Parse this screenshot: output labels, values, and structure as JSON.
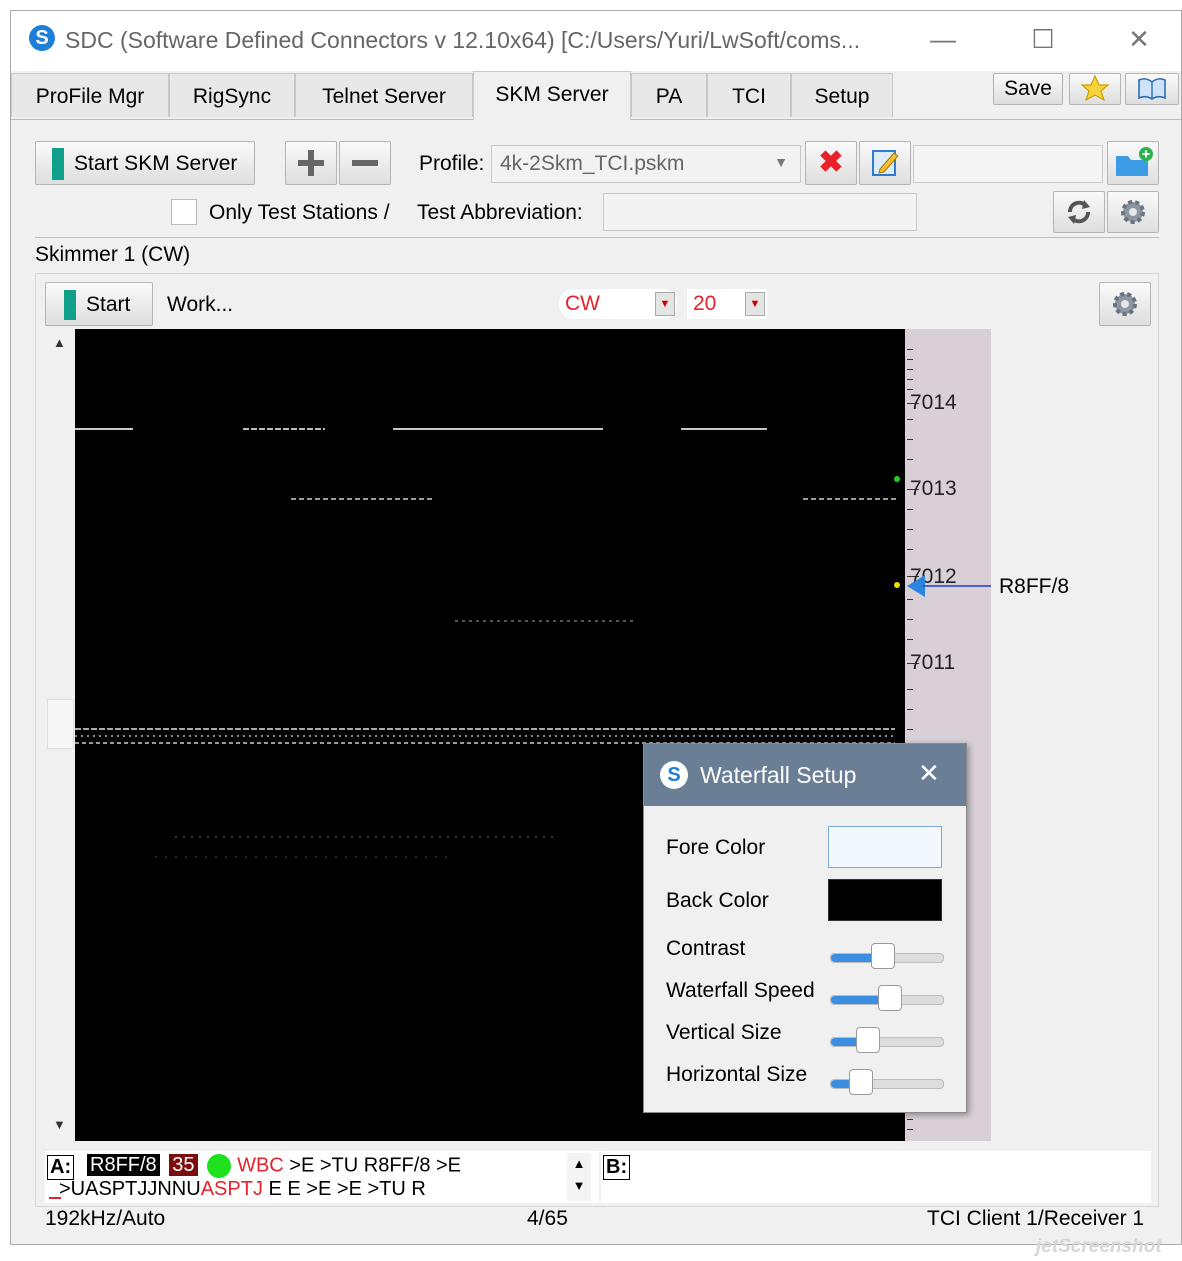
{
  "window": {
    "title": "SDC (Software Defined Connectors v 12.10x64) [C:/Users/Yuri/LwSoft/coms...",
    "logo_letter": "S",
    "minimize": "—",
    "maximize": "☐",
    "close": "✕"
  },
  "tabs": [
    {
      "label": "ProFile Mgr"
    },
    {
      "label": "RigSync"
    },
    {
      "label": "Telnet Server"
    },
    {
      "label": "SKM Server"
    },
    {
      "label": "PA"
    },
    {
      "label": "TCI"
    },
    {
      "label": "Setup"
    }
  ],
  "toolbar": {
    "save_label": "Save"
  },
  "server": {
    "start_label": "Start SKM Server",
    "profile_label": "Profile:",
    "profile_value": "4k-2Skm_TCI.pskm",
    "only_test_label": "Only Test Stations /",
    "test_abbrev_label": "Test Abbreviation:",
    "test_abbrev_value": ""
  },
  "skimmer": {
    "title": "Skimmer 1 (CW)",
    "start_label": "Start",
    "status": "Work...",
    "mode": "CW",
    "speed": "20"
  },
  "scale": {
    "labels": [
      "7014",
      "7013",
      "7012",
      "7011"
    ],
    "spot_call": "R8FF/8"
  },
  "decoder": {
    "a_label": "A:",
    "b_label": "B:",
    "line1_call": "R8FF/8",
    "line1_snr": "35",
    "line1_red": "WBC",
    "line1_rest": ">E >TU R8FF/8 >E",
    "line2_prefix": ">UASPTJJNNU",
    "line2_red": "ASPTJ",
    "line2_rest": "E E >E >E >TU R"
  },
  "waterfall_dialog": {
    "title": "Waterfall Setup",
    "logo_letter": "S",
    "close": "✕",
    "fore_color_label": "Fore Color",
    "back_color_label": "Back Color",
    "contrast_label": "Contrast",
    "speed_label": "Waterfall Speed",
    "vertical_label": "Vertical Size",
    "horizontal_label": "Horizontal Size",
    "fore_color": "#f3f7fe",
    "back_color": "#000000",
    "contrast_level": 0.45,
    "speed_level": 0.53,
    "vertical_level": 0.28,
    "horizontal_level": 0.2
  },
  "status": {
    "left": "192kHz/Auto",
    "center": "4/65",
    "right": "TCI Client 1/Receiver 1"
  },
  "watermark": "jetScreenshot",
  "colors": {
    "accent": "#10a08a",
    "red": "#e8222a",
    "blue": "#1e7fd6"
  }
}
